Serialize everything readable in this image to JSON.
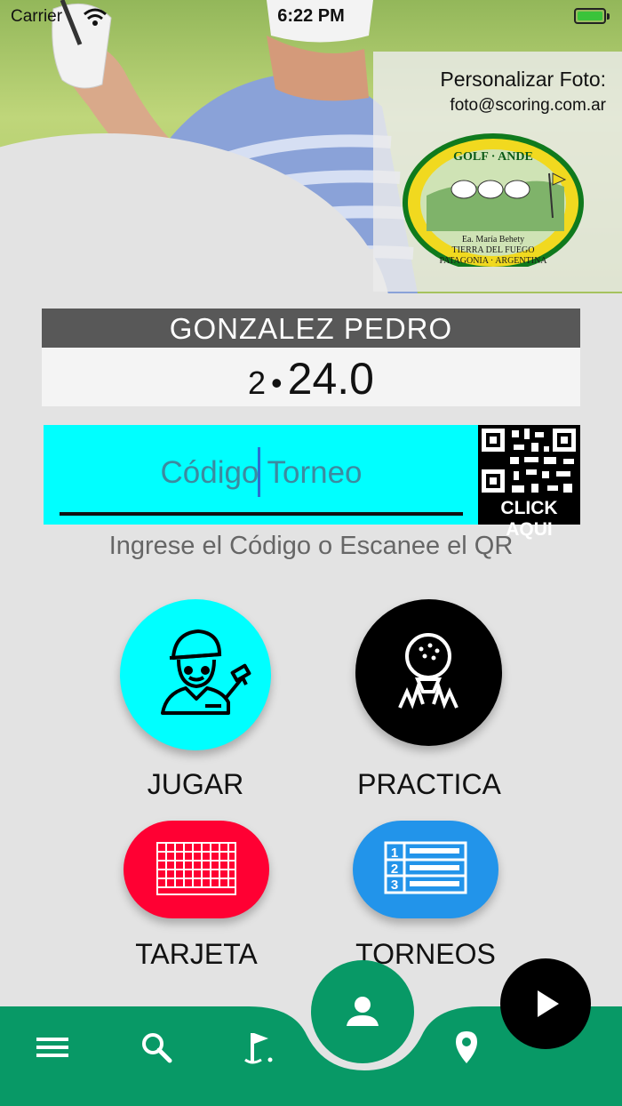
{
  "status": {
    "carrier": "Carrier",
    "time": "6:22 PM"
  },
  "photo": {
    "title": "Personalizar Foto:",
    "email": "foto@scoring.com.ar"
  },
  "logo": {
    "top_text": "GOLF ... ANDE",
    "line1": "Ea. María Behety",
    "line2": "TIERRA DEL FUEGO",
    "line3": "PATAGONIA · ARGENTINA"
  },
  "player": {
    "name": "GONZALEZ PEDRO",
    "handicap_index": "2",
    "handicap_value": "24.0"
  },
  "code": {
    "placeholder": "Código Torneo",
    "qr_label": "CLICK AQUI",
    "hint": "Ingrese el Código o Escanee el QR"
  },
  "buttons": {
    "jugar": "JUGAR",
    "practica": "PRACTICA",
    "tarjeta": "TARJETA",
    "torneos": "TORNEOS"
  },
  "torneos_icon_numbers": [
    "1",
    "2",
    "3"
  ],
  "colors": {
    "cyan": "#00ffff",
    "red": "#ff0033",
    "blue": "#2294ea",
    "green": "#089966",
    "black": "#000000",
    "name_bar": "#585858"
  },
  "nav": {
    "icons": [
      "menu-icon",
      "search-icon",
      "golf-flag-icon",
      "profile-icon",
      "location-pin-icon",
      "play-icon"
    ]
  }
}
